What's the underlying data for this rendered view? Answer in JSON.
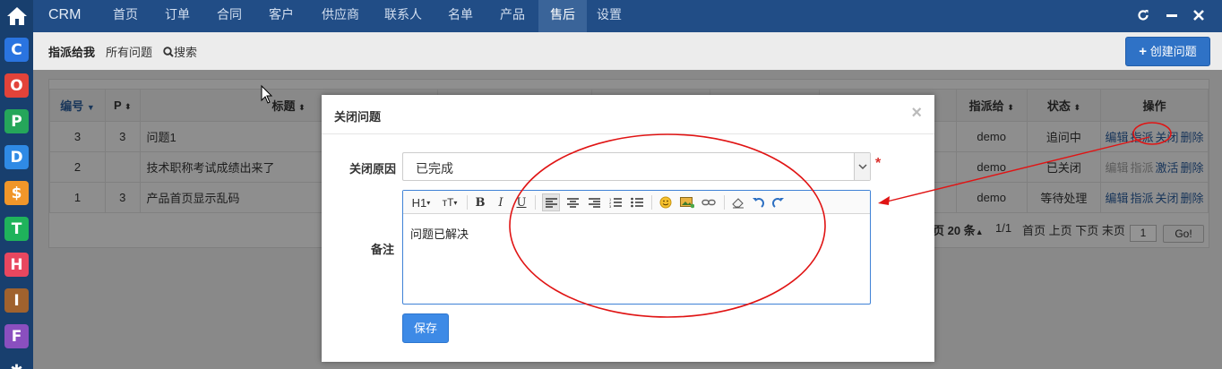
{
  "appbar": {
    "apps": [
      {
        "letter": "C",
        "color": "#2a74e0"
      },
      {
        "letter": "O",
        "color": "#e2433a"
      },
      {
        "letter": "P",
        "color": "#25a65a"
      },
      {
        "letter": "D",
        "color": "#2f8ae5"
      },
      {
        "letter": "$",
        "color": "#f0962a"
      },
      {
        "letter": "T",
        "color": "#1fb35b"
      },
      {
        "letter": "H",
        "color": "#e8475f"
      },
      {
        "letter": "I",
        "color": "#a0622e"
      },
      {
        "letter": "F",
        "color": "#8a4fbf"
      }
    ]
  },
  "nav": {
    "brand": "CRM",
    "items": [
      "首页",
      "订单",
      "合同",
      "客户",
      "供应商",
      "联系人",
      "名单",
      "产品",
      "售后",
      "设置"
    ],
    "active": "售后"
  },
  "subnav": {
    "tabs": [
      "指派给我",
      "所有问题",
      "搜索"
    ],
    "create_button": "创建问题"
  },
  "table": {
    "headers": {
      "id": "编号",
      "pri": "P",
      "title": "标题",
      "assigned": "指派给",
      "status": "状态",
      "actions": "操作"
    },
    "rows": [
      {
        "id": "3",
        "pri": "3",
        "title": "问题1",
        "assigned": "demo",
        "status": "追问中",
        "actions": [
          "编辑",
          "指派",
          "关闭",
          "删除"
        ],
        "dim": [
          false,
          false,
          false,
          false
        ]
      },
      {
        "id": "2",
        "pri": "",
        "title": "技术职称考试成绩出来了",
        "assigned": "demo",
        "status": "已关闭",
        "actions": [
          "编辑",
          "指派",
          "激活",
          "删除"
        ],
        "dim": [
          true,
          true,
          false,
          false
        ]
      },
      {
        "id": "1",
        "pri": "3",
        "title": "产品首页显示乱码",
        "assigned": "demo",
        "status": "等待处理",
        "actions": [
          "编辑",
          "指派",
          "关闭",
          "删除"
        ],
        "dim": [
          false,
          false,
          false,
          false
        ]
      }
    ],
    "pager": {
      "per_page": "页 20 条",
      "page_info": "1/1",
      "links": "首页 上页 下页 末页",
      "page_input": "1",
      "go": "Go!"
    }
  },
  "modal": {
    "title": "关闭问题",
    "reason_label": "关闭原因",
    "reason_value": "已完成",
    "required_mark": "*",
    "note_label": "备注",
    "toolbar": {
      "heading": "H1",
      "fontsize": "ᴛT"
    },
    "note_content": "问题已解决",
    "save_button": "保存"
  },
  "colors": {
    "topbar": "#214d86",
    "appbar": "#183f6e",
    "accent": "#2f72c6",
    "annotation": "#e01414"
  }
}
